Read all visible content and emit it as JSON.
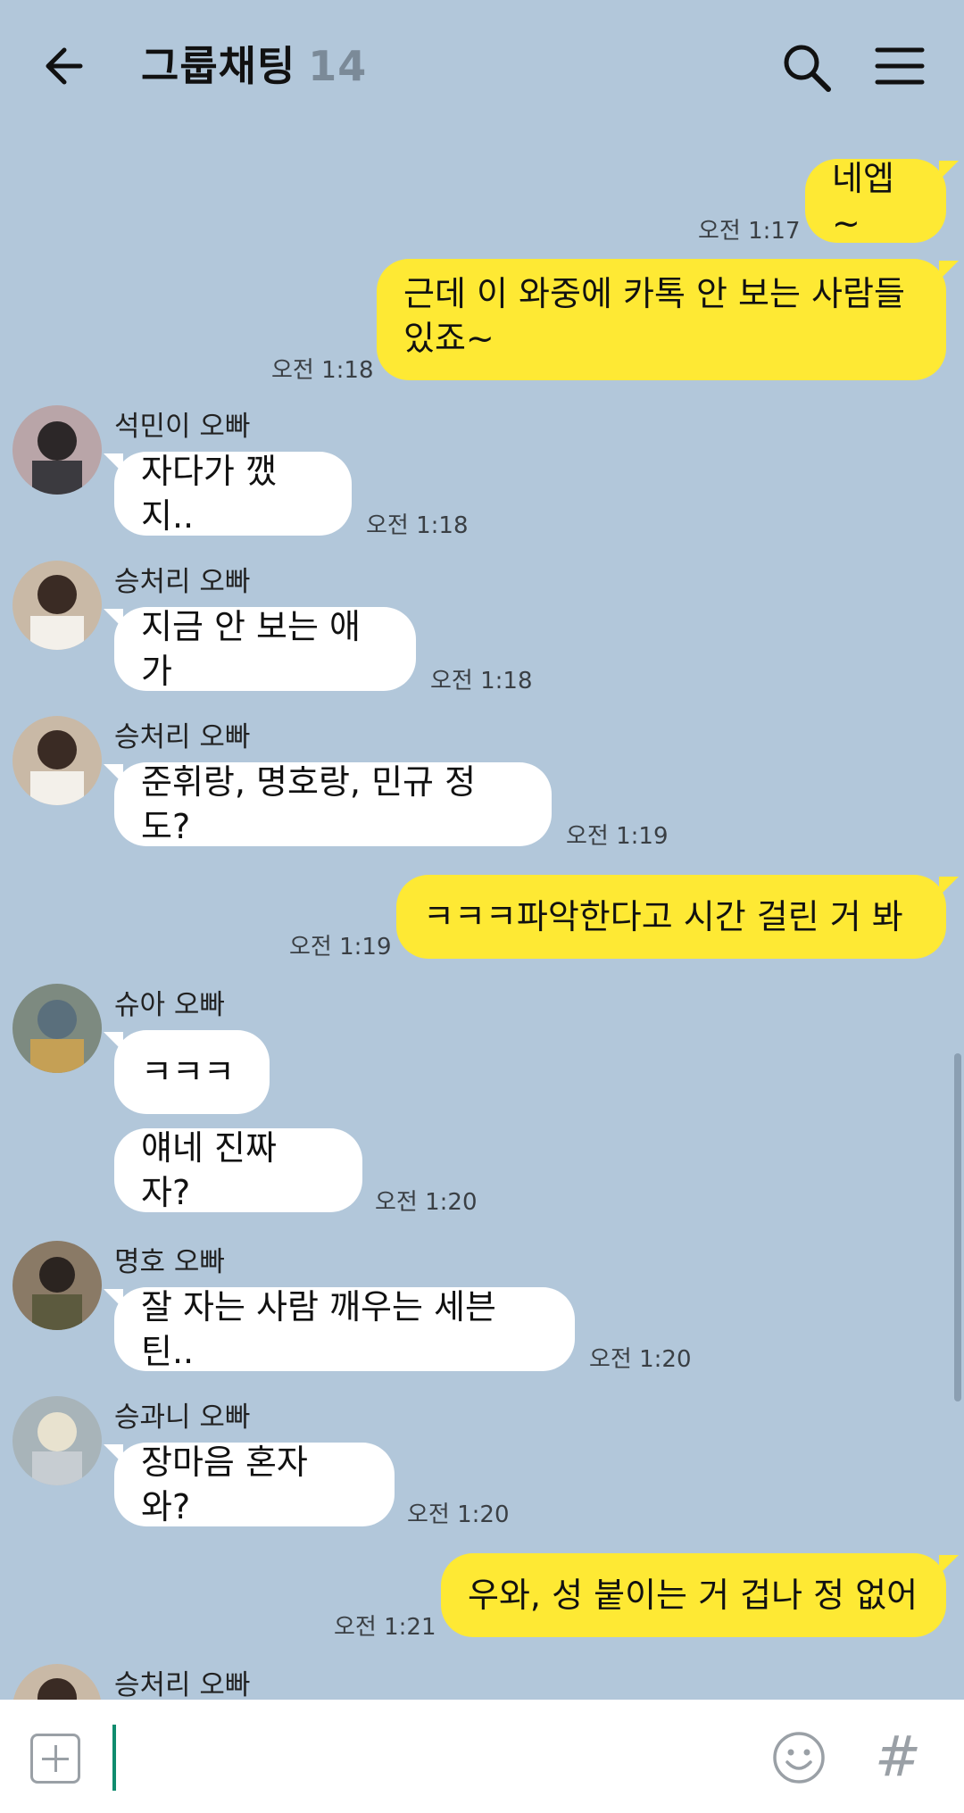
{
  "header": {
    "title": "그룹채팅",
    "member_count": "14"
  },
  "messages": [
    {
      "text": "네엡~",
      "time": "오전 1:17"
    },
    {
      "text": "근데 이 와중에 카톡 안 보는 사람들 있죠~",
      "time": "오전 1:18"
    },
    {
      "sender": "석민이 오빠",
      "text": "자다가 깼지..",
      "time": "오전 1:18"
    },
    {
      "sender": "승처리 오빠",
      "text": "지금 안 보는 애가",
      "time": "오전 1:18"
    },
    {
      "sender": "승처리 오빠",
      "text": "준휘랑, 명호랑, 민규 정도?",
      "time": "오전 1:19"
    },
    {
      "text": "ㅋㅋㅋ파악한다고 시간 걸린 거 봐",
      "time": "오전 1:19"
    },
    {
      "sender": "슈아 오빠",
      "text": "ㅋㅋㅋ"
    },
    {
      "text": "얘네 진짜 자?",
      "time": "오전 1:20"
    },
    {
      "sender": "명호 오빠",
      "text": "잘 자는 사람 깨우는 세븐틴..",
      "time": "오전 1:20"
    },
    {
      "sender": "승과니 오빠",
      "text": "장마음 혼자 와?",
      "time": "오전 1:20"
    },
    {
      "text": "우와, 성 붙이는 거 겁나 정 없어",
      "time": "오전 1:21"
    },
    {
      "sender": "승처리 오빠"
    }
  ],
  "colors": {
    "background": "#b2c7da",
    "my_bubble": "#fee934",
    "their_bubble": "#ffffff"
  },
  "icons": [
    "back-arrow-icon",
    "search-icon",
    "menu-icon",
    "plus-icon",
    "emoji-icon",
    "hashtag-icon"
  ],
  "input": {
    "value": "",
    "hash_symbol": "#"
  }
}
